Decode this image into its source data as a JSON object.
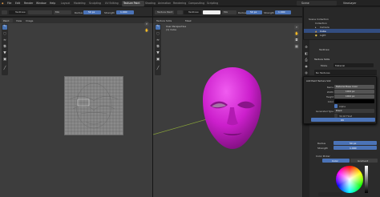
{
  "menubar": {
    "items": [
      "File",
      "Edit",
      "Render",
      "Window",
      "Help"
    ],
    "workspaces": [
      "Layout",
      "Modeling",
      "Sculpting",
      "UV Editing",
      "Texture Paint",
      "Shading",
      "Animation",
      "Rendering",
      "Compositing",
      "Scripting"
    ],
    "active_workspace": "Texture Paint",
    "scene": "Scene",
    "view_layer": "ViewLayer"
  },
  "left_toolbar": {
    "brush_name": "TexDraw",
    "blend": "Mix",
    "radius_label": "Radius",
    "radius_value": "50 px",
    "strength_label": "Strength",
    "strength_value": "1.000"
  },
  "uv_header": {
    "mode": "Paint",
    "view": "View",
    "image": "Image"
  },
  "right_toolbar": {
    "mode": "Texture Paint",
    "brush_name": "TexDraw",
    "blend": "Mix",
    "radius_label": "Radius",
    "radius_value": "50 px",
    "strength_label": "Strength",
    "strength_value": "1.000",
    "texture_slots": "Texture Slots",
    "mask": "Mask"
  },
  "viewport": {
    "view_title": "User Perspective",
    "object_name": "(1) Cube",
    "mesh_color": "#cc1fcc"
  },
  "outliner": {
    "title": "Scene Collection",
    "rows": [
      "Collection",
      "Camera",
      "Cube",
      "Light"
    ],
    "selected_row": "Cube"
  },
  "properties": {
    "brush_name": "TexDraw",
    "texture_slots_title": "Texture Slots",
    "mode_label": "Mode",
    "mode_value": "Material",
    "no_textures": "No Textures"
  },
  "popup": {
    "title": "Add Paint Texture Slot",
    "fields": [
      {
        "label": "Name",
        "value": "Material Base Color"
      },
      {
        "label": "Width",
        "value": "1024 px"
      },
      {
        "label": "Height",
        "value": "1024 px"
      },
      {
        "label": "Color",
        "value": ""
      },
      {
        "label": "",
        "value": "Alpha"
      },
      {
        "label": "Generated Type",
        "value": "Blank"
      },
      {
        "label": "",
        "value": "32-bit Float"
      }
    ],
    "alpha_checked": true,
    "float_checked": false,
    "ok_label": "OK"
  },
  "brush_settings": {
    "radius_label": "Radius",
    "radius_value": "50 px",
    "strength_label": "Strength",
    "strength_value": "1.000",
    "color_picker_title": "Color Picker",
    "color_tab": "Color",
    "gradient_tab": "Gradient"
  },
  "colors": {
    "accent": "#4772b3",
    "uv_grid": "#8a8a8a",
    "selection": "#334d80",
    "mesh": "#cc1fcc"
  }
}
